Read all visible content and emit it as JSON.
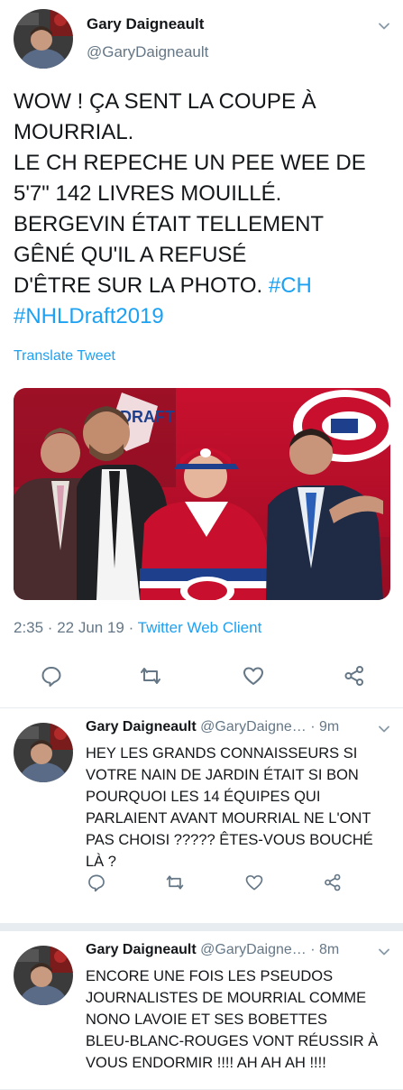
{
  "main": {
    "name": "Gary Daigneault",
    "handle": "@GaryDaigneault",
    "text_lines": [
      "WOW ! ÇA SENT LA COUPE À",
      "MOURRIAL.",
      "LE CH REPECHE UN PEE WEE DE",
      "5'7\" 142 LIVRES MOUILLÉ.",
      "BERGEVIN ÉTAIT TELLEMENT",
      "GÊNÉ QU'IL A REFUSÉ",
      "D'ÊTRE SUR LA PHOTO."
    ],
    "hashtag1": "#CH",
    "hashtag2": "#NHLDraft2019",
    "translate": "Translate Tweet",
    "time": "2:35 · 22 Jun 19 · ",
    "client": "Twitter Web Client",
    "photo_text": "DRAFT"
  },
  "replies": [
    {
      "name": "Gary Daigneault",
      "handle": "@GaryDaigne…",
      "time": " · 9m",
      "text": "HEY LES GRANDS CONNAISSEURS SI\nVOTRE NAIN DE JARDIN ÉTAIT SI BON\nPOURQUOI LES 14 ÉQUIPES QUI\nPARLAIENT AVANT MOURRIAL NE L'ONT\nPAS CHOISI ????? ÊTES-VOUS BOUCHÉ\nLÀ ?"
    },
    {
      "name": "Gary Daigneault",
      "handle": "@GaryDaigne…",
      "time": " · 8m",
      "text": "ENCORE UNE FOIS LES PSEUDOS\nJOURNALISTES DE MOURRIAL COMME\nNONO LAVOIE ET SES BOBETTES\nBLEU-BLANC-ROUGES VONT RÉUSSIR À\nVOUS ENDORMIR !!!! AH AH AH !!!!"
    }
  ],
  "icons": [
    "chevron-down-icon",
    "reply-icon",
    "retweet-icon",
    "like-icon",
    "share-icon"
  ],
  "colors": {
    "link": "#1da1f2",
    "secondary": "#657786",
    "text": "#14171a",
    "divider": "#e6ecf0"
  }
}
